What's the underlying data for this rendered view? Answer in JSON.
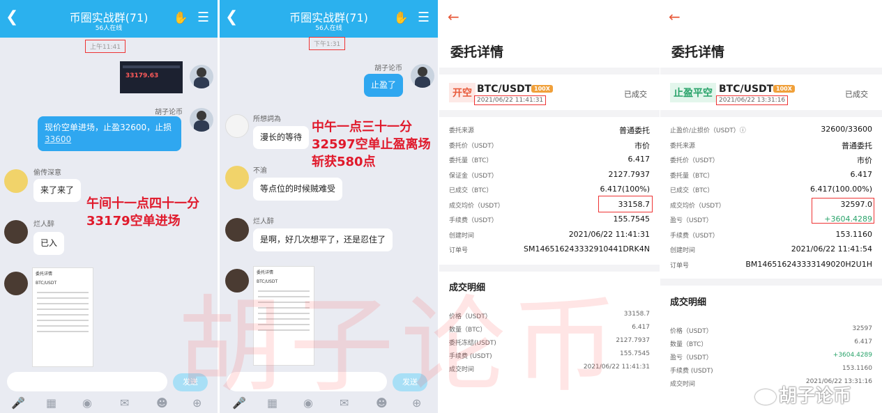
{
  "chat1": {
    "title": "币圈实战群(71)",
    "online": "56人在线",
    "time": "上午11:41",
    "market_price": "33179.63",
    "sender_me": "胡子论币",
    "msg_me": "现价空单进场，止盈32600，止损",
    "msg_me_link": "33600",
    "u1": "偷传深意",
    "m1": "来了来了",
    "u2": "烂人醉",
    "m2": "已入",
    "annot": [
      "午间十一点四十一分",
      "33179空单进场"
    ],
    "thumb_title": "委托详情",
    "thumb_pair": "BTC/USDT",
    "send": "发送"
  },
  "chat2": {
    "title": "币圈实战群(71)",
    "online": "56人在线",
    "time": "下午1:31",
    "sender_me": "胡子论币",
    "msg_me": "止盈了",
    "u1": "所想詞為",
    "m1": "漫长的等待",
    "u2": "不渝",
    "m2": "等点位的时候贼难受",
    "u3": "烂人醉",
    "m3": "是啊，好几次想平了，还是忍住了",
    "annot": [
      "中午一点三十一分",
      "32597空单止盈离场",
      "斩获580点"
    ],
    "thumb_title": "委托详情",
    "thumb_pair": "BTC/USDT",
    "send": "发送"
  },
  "order1": {
    "title": "委托详情",
    "tag": "开空",
    "pair": "BTC/USDT",
    "lev": "100X",
    "status": "已成交",
    "ts": "2021/06/22 11:41:31",
    "rows": [
      {
        "k": "委托来源",
        "v": "普通委托"
      },
      {
        "k": "委托价（USDT）",
        "v": "市价"
      },
      {
        "k": "委托量（BTC）",
        "v": "6.417"
      },
      {
        "k": "保证金（USDT）",
        "v": "2127.7937"
      },
      {
        "k": "已成交（BTC）",
        "v": "6.417(100%)"
      },
      {
        "k": "成交均价（USDT）",
        "v": "33158.7"
      },
      {
        "k": "手续费（USDT）",
        "v": "155.7545"
      },
      {
        "k": "创建时间",
        "v": "2021/06/22 11:41:31"
      },
      {
        "k": "订单号",
        "v": "SM146516243332910441DRK4N"
      }
    ],
    "detail_title": "成交明细",
    "detail": [
      {
        "k": "价格（USDT）",
        "v": "33158.7"
      },
      {
        "k": "数量（BTC）",
        "v": "6.417"
      },
      {
        "k": "委托冻结(USDT)",
        "v": "2127.7937"
      },
      {
        "k": "手续费 (USDT)",
        "v": "155.7545"
      },
      {
        "k": "成交时间",
        "v": "2021/06/22 11:41:31"
      }
    ]
  },
  "order2": {
    "title": "委托详情",
    "tag": "止盈平空",
    "pair": "BTC/USDT",
    "lev": "100X",
    "status": "已成交",
    "ts": "2021/06/22 13:31:16",
    "rows": [
      {
        "k": "止盈价/止损价（USDT）ⓘ",
        "v": "32600/33600"
      },
      {
        "k": "委托来源",
        "v": "普通委托"
      },
      {
        "k": "委托价（USDT）",
        "v": "市价"
      },
      {
        "k": "委托量（BTC）",
        "v": "6.417"
      },
      {
        "k": "已成交（BTC）",
        "v": "6.417(100.00%)"
      },
      {
        "k": "成交均价（USDT）",
        "v": "32597.0"
      },
      {
        "k": "盈亏（USDT）",
        "v": "+3604.4289"
      },
      {
        "k": "手续费（USDT）",
        "v": "153.1160"
      },
      {
        "k": "创建时间",
        "v": "2021/06/22 11:41:54"
      },
      {
        "k": "订单号",
        "v": "BM146516243333149020H2U1H"
      }
    ],
    "detail_title": "成交明细",
    "detail": [
      {
        "k": "价格（USDT）",
        "v": "32597"
      },
      {
        "k": "数量（BTC）",
        "v": "6.417"
      },
      {
        "k": "盈亏（USDT）",
        "v": "+3604.4289"
      },
      {
        "k": "手续费 (USDT)",
        "v": "153.1160"
      },
      {
        "k": "成交时间",
        "v": "2021/06/22 13:31:16"
      }
    ]
  },
  "watermark": "胡子论币",
  "weibo": "胡子论币"
}
